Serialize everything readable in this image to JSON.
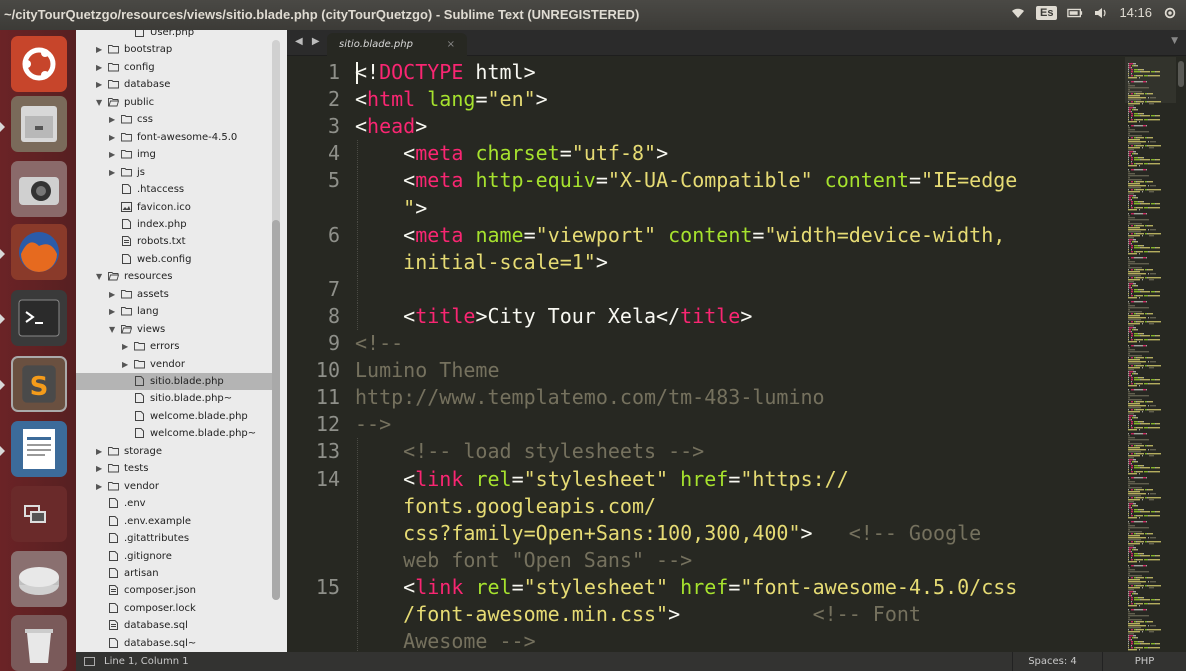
{
  "window": {
    "title": "~/cityTourQuetzgo/resources/views/sitio.blade.php (cityTourQuetzgo) - Sublime Text (UNREGISTERED)",
    "keyboard": "Es",
    "clock": "14:16"
  },
  "launcher": {
    "items": [
      "ubuntu-dash",
      "files",
      "camera",
      "firefox",
      "terminal",
      "sublime-text",
      "libreoffice-writer",
      "workspace-switcher",
      "disk",
      "trash"
    ]
  },
  "sidebar": {
    "items": [
      {
        "label": "User.php",
        "type": "file",
        "depth": 3
      },
      {
        "label": "bootstrap",
        "type": "folder",
        "depth": 1,
        "open": false
      },
      {
        "label": "config",
        "type": "folder",
        "depth": 1,
        "open": false
      },
      {
        "label": "database",
        "type": "folder",
        "depth": 1,
        "open": false
      },
      {
        "label": "public",
        "type": "folder",
        "depth": 1,
        "open": true
      },
      {
        "label": "css",
        "type": "folder",
        "depth": 2,
        "open": false
      },
      {
        "label": "font-awesome-4.5.0",
        "type": "folder",
        "depth": 2,
        "open": false
      },
      {
        "label": "img",
        "type": "folder",
        "depth": 2,
        "open": false
      },
      {
        "label": "js",
        "type": "folder",
        "depth": 2,
        "open": false
      },
      {
        "label": ".htaccess",
        "type": "file",
        "depth": 2
      },
      {
        "label": "favicon.ico",
        "type": "image",
        "depth": 2
      },
      {
        "label": "index.php",
        "type": "file",
        "depth": 2
      },
      {
        "label": "robots.txt",
        "type": "text",
        "depth": 2
      },
      {
        "label": "web.config",
        "type": "file",
        "depth": 2
      },
      {
        "label": "resources",
        "type": "folder",
        "depth": 1,
        "open": true
      },
      {
        "label": "assets",
        "type": "folder",
        "depth": 2,
        "open": false
      },
      {
        "label": "lang",
        "type": "folder",
        "depth": 2,
        "open": false
      },
      {
        "label": "views",
        "type": "folder",
        "depth": 2,
        "open": true
      },
      {
        "label": "errors",
        "type": "folder",
        "depth": 3,
        "open": false
      },
      {
        "label": "vendor",
        "type": "folder",
        "depth": 3,
        "open": false
      },
      {
        "label": "sitio.blade.php",
        "type": "file",
        "depth": 3,
        "selected": true
      },
      {
        "label": "sitio.blade.php~",
        "type": "file",
        "depth": 3
      },
      {
        "label": "welcome.blade.php",
        "type": "file",
        "depth": 3
      },
      {
        "label": "welcome.blade.php~",
        "type": "file",
        "depth": 3
      },
      {
        "label": "storage",
        "type": "folder",
        "depth": 1,
        "open": false
      },
      {
        "label": "tests",
        "type": "folder",
        "depth": 1,
        "open": false
      },
      {
        "label": "vendor",
        "type": "folder",
        "depth": 1,
        "open": false
      },
      {
        "label": ".env",
        "type": "file",
        "depth": 1
      },
      {
        "label": ".env.example",
        "type": "file",
        "depth": 1
      },
      {
        "label": ".gitattributes",
        "type": "file",
        "depth": 1
      },
      {
        "label": ".gitignore",
        "type": "file",
        "depth": 1
      },
      {
        "label": "artisan",
        "type": "file",
        "depth": 1
      },
      {
        "label": "composer.json",
        "type": "text",
        "depth": 1
      },
      {
        "label": "composer.lock",
        "type": "file",
        "depth": 1
      },
      {
        "label": "database.sql",
        "type": "text",
        "depth": 1
      },
      {
        "label": "database.sql~",
        "type": "file",
        "depth": 1
      }
    ]
  },
  "tabs": {
    "nav": "◀ ▶",
    "active": "sitio.blade.php",
    "close": "×",
    "menu": "▼"
  },
  "editor": {
    "lines": [
      {
        "n": "1",
        "guide": 0,
        "segs": [
          [
            "p",
            "<!"
          ],
          [
            "t",
            "DOCTYPE"
          ],
          [
            "p",
            " html>"
          ]
        ]
      },
      {
        "n": "2",
        "guide": 0,
        "segs": [
          [
            "p",
            "<"
          ],
          [
            "t",
            "html"
          ],
          [
            "p",
            " "
          ],
          [
            "a",
            "lang"
          ],
          [
            "p",
            "="
          ],
          [
            "s",
            "\"en\""
          ],
          [
            "p",
            ">"
          ]
        ]
      },
      {
        "n": "3",
        "guide": 0,
        "segs": [
          [
            "p",
            "<"
          ],
          [
            "t",
            "head"
          ],
          [
            "p",
            ">"
          ]
        ]
      },
      {
        "n": "4",
        "guide": 1,
        "segs": [
          [
            "p",
            "    <"
          ],
          [
            "t",
            "meta"
          ],
          [
            "p",
            " "
          ],
          [
            "a",
            "charset"
          ],
          [
            "p",
            "="
          ],
          [
            "s",
            "\"utf-8\""
          ],
          [
            "p",
            ">"
          ]
        ]
      },
      {
        "n": "5",
        "guide": 1,
        "segs": [
          [
            "p",
            "    <"
          ],
          [
            "t",
            "meta"
          ],
          [
            "p",
            " "
          ],
          [
            "a",
            "http-equiv"
          ],
          [
            "p",
            "="
          ],
          [
            "s",
            "\"X-UA-Compatible\""
          ],
          [
            "p",
            " "
          ],
          [
            "a",
            "content"
          ],
          [
            "p",
            "="
          ],
          [
            "s",
            "\"IE=edge"
          ]
        ]
      },
      {
        "n": "",
        "guide": 1,
        "segs": [
          [
            "s",
            "    \""
          ],
          [
            "p",
            ">"
          ]
        ]
      },
      {
        "n": "6",
        "guide": 1,
        "segs": [
          [
            "p",
            "    <"
          ],
          [
            "t",
            "meta"
          ],
          [
            "p",
            " "
          ],
          [
            "a",
            "name"
          ],
          [
            "p",
            "="
          ],
          [
            "s",
            "\"viewport\""
          ],
          [
            "p",
            " "
          ],
          [
            "a",
            "content"
          ],
          [
            "p",
            "="
          ],
          [
            "s",
            "\"width=device-width,"
          ]
        ]
      },
      {
        "n": "",
        "guide": 1,
        "segs": [
          [
            "s",
            "    initial-scale=1\""
          ],
          [
            "p",
            ">"
          ]
        ]
      },
      {
        "n": "7",
        "guide": 1,
        "segs": [
          [
            "p",
            ""
          ]
        ]
      },
      {
        "n": "8",
        "guide": 1,
        "segs": [
          [
            "p",
            "    <"
          ],
          [
            "t",
            "title"
          ],
          [
            "p",
            ">City Tour Xela</"
          ],
          [
            "t",
            "title"
          ],
          [
            "p",
            ">"
          ]
        ]
      },
      {
        "n": "9",
        "guide": 0,
        "segs": [
          [
            "c",
            "<!--"
          ]
        ]
      },
      {
        "n": "10",
        "guide": 0,
        "segs": [
          [
            "c",
            "Lumino Theme"
          ]
        ]
      },
      {
        "n": "11",
        "guide": 0,
        "segs": [
          [
            "c",
            "http://www.templatemo.com/tm-483-lumino"
          ]
        ]
      },
      {
        "n": "12",
        "guide": 0,
        "segs": [
          [
            "c",
            "-->"
          ]
        ]
      },
      {
        "n": "13",
        "guide": 1,
        "segs": [
          [
            "c",
            "    <!-- load stylesheets -->"
          ]
        ]
      },
      {
        "n": "14",
        "guide": 1,
        "segs": [
          [
            "p",
            "    <"
          ],
          [
            "t",
            "link"
          ],
          [
            "p",
            " "
          ],
          [
            "a",
            "rel"
          ],
          [
            "p",
            "="
          ],
          [
            "s",
            "\"stylesheet\""
          ],
          [
            "p",
            " "
          ],
          [
            "a",
            "href"
          ],
          [
            "p",
            "="
          ],
          [
            "s",
            "\"https://"
          ]
        ]
      },
      {
        "n": "",
        "guide": 1,
        "segs": [
          [
            "s",
            "    fonts.googleapis.com/"
          ]
        ]
      },
      {
        "n": "",
        "guide": 1,
        "segs": [
          [
            "s",
            "    css?family=Open+Sans:100,300,400\""
          ],
          [
            "p",
            ">   "
          ],
          [
            "c",
            "<!-- Google"
          ]
        ]
      },
      {
        "n": "",
        "guide": 1,
        "segs": [
          [
            "c",
            "    web font \"Open Sans\" -->"
          ]
        ]
      },
      {
        "n": "15",
        "guide": 1,
        "segs": [
          [
            "p",
            "    <"
          ],
          [
            "t",
            "link"
          ],
          [
            "p",
            " "
          ],
          [
            "a",
            "rel"
          ],
          [
            "p",
            "="
          ],
          [
            "s",
            "\"stylesheet\""
          ],
          [
            "p",
            " "
          ],
          [
            "a",
            "href"
          ],
          [
            "p",
            "="
          ],
          [
            "s",
            "\"font-awesome-4.5.0/css"
          ]
        ]
      },
      {
        "n": "",
        "guide": 1,
        "segs": [
          [
            "s",
            "    /font-awesome.min.css\""
          ],
          [
            "p",
            ">           "
          ],
          [
            "c",
            "<!-- Font"
          ]
        ]
      },
      {
        "n": "",
        "guide": 1,
        "segs": [
          [
            "c",
            "    Awesome -->"
          ]
        ]
      }
    ]
  },
  "status": {
    "position": "Line 1, Column 1",
    "spaces": "Spaces: 4",
    "syntax": "PHP"
  },
  "colors": {
    "editor_bg": "#272822",
    "tag": "#f92672",
    "attr": "#a6e22e",
    "string": "#e6db74",
    "comment": "#75715e",
    "plain": "#f8f8f2"
  }
}
